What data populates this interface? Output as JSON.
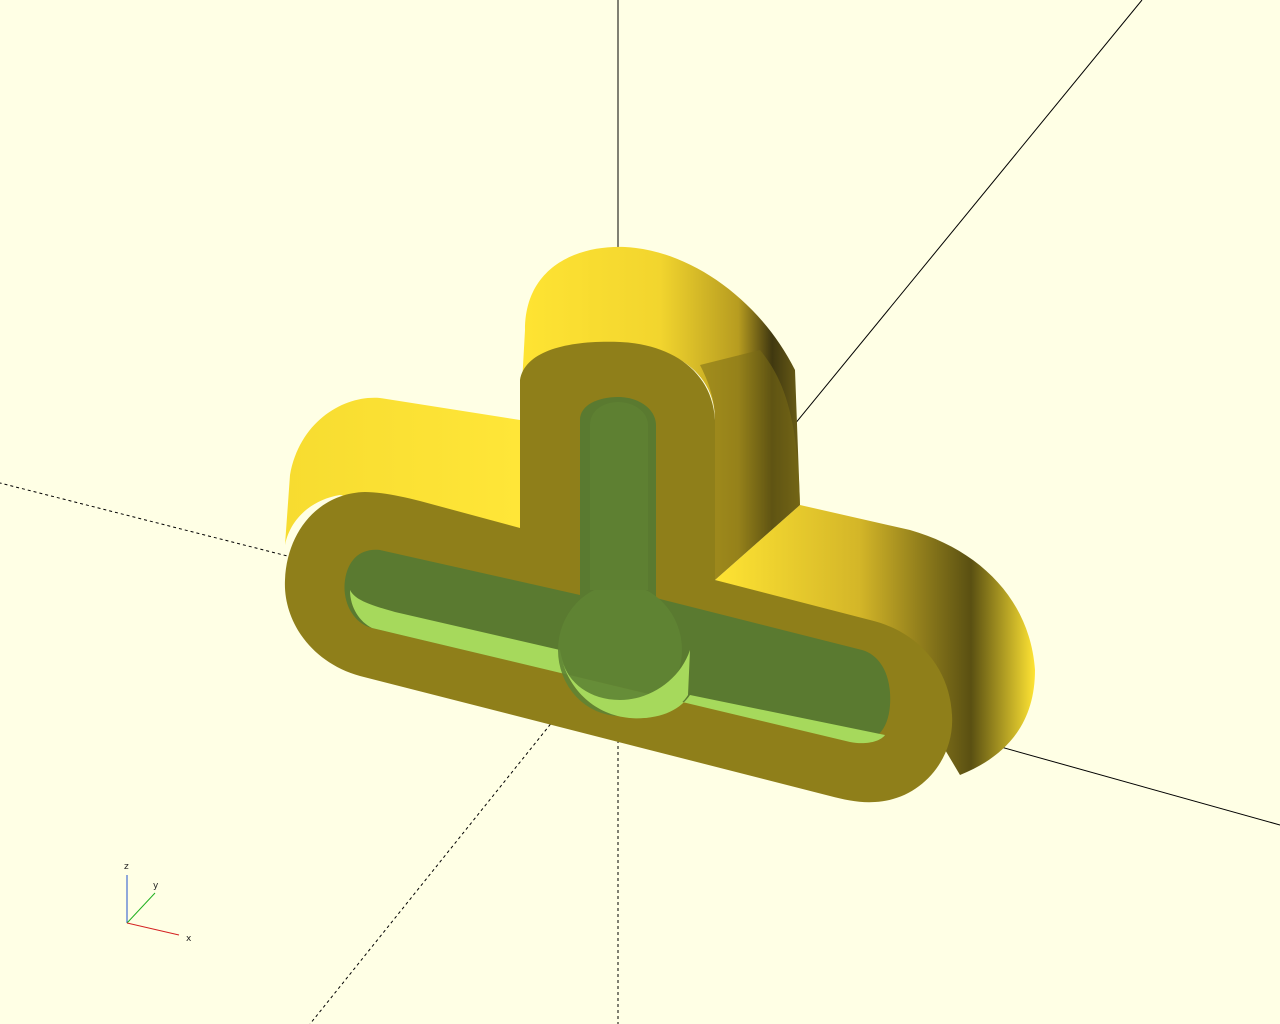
{
  "viewport": {
    "background": "#ffffe5",
    "axes": {
      "x_color": "#000000",
      "y_color": "#000000",
      "z_color": "#000000"
    }
  },
  "model": {
    "top_face_color": "#ffe433",
    "side_face_color": "#8f7f1a",
    "dark_side_color": "#4a4210",
    "inner_cavity_color": "#5a7a30",
    "inner_highlight_color": "#a6d95c"
  },
  "axis_gizmo": {
    "labels": {
      "x": "x",
      "y": "y",
      "z": "z"
    },
    "colors": {
      "x": "#d42020",
      "y": "#20b020",
      "z": "#2050d0"
    }
  }
}
